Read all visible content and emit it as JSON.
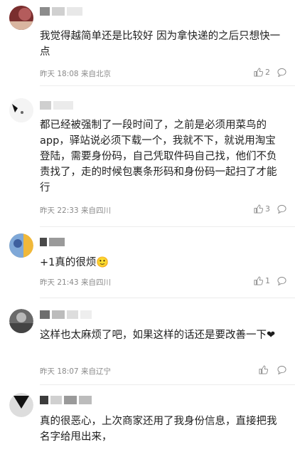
{
  "comments": [
    {
      "text": "我觉得越简单还是比较好 因为拿快递的之后只想快一点",
      "time": "昨天 18:08",
      "location": "来自北京",
      "likes": "2"
    },
    {
      "text": "都已经被强制了一段时间了，之前是必须用菜鸟的app，驿站说必须下载一个，我就不下，就说用淘宝登陆，需要身份码，自己凭取件码自己找，他们不负责找了，走的时候包裹条形码和身份码一起扫了才能行",
      "time": "昨天 22:33",
      "location": "来自四川",
      "likes": "3"
    },
    {
      "text": "+1真的很烦🙂",
      "time": "昨天 21:43",
      "location": "来自四川",
      "likes": "1"
    },
    {
      "text": "这样也太麻烦了吧，如果这样的话还是要改善一下❤",
      "time": "昨天 18:07",
      "location": "来自辽宁",
      "likes": ""
    },
    {
      "text": "真的很恶心，上次商家还用了我身份信息，直接把我名字给甩出来，",
      "time": "",
      "location": "",
      "likes": ""
    }
  ],
  "icons": {
    "like": "thumbs-up-icon",
    "comment": "comment-bubble-icon"
  },
  "colors": {
    "text": "#1e1e1e",
    "meta": "#8a8a8a",
    "heart": "#e0443a"
  }
}
